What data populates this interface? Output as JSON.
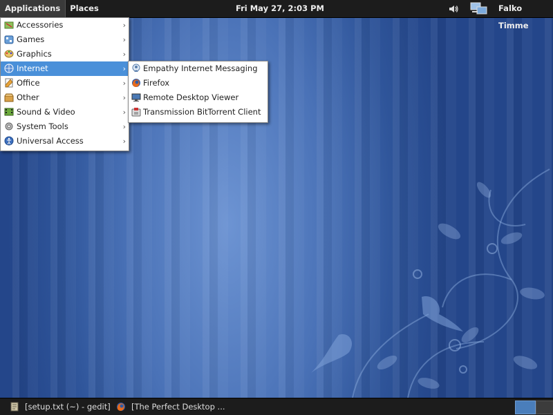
{
  "top_panel": {
    "applications_label": "Applications",
    "places_label": "Places",
    "clock": "Fri May 27,  2:03 PM",
    "user_name": "Falko Timme"
  },
  "apps_menu": {
    "items": [
      {
        "label": "Accessories",
        "icon": "accessories-icon"
      },
      {
        "label": "Games",
        "icon": "games-icon"
      },
      {
        "label": "Graphics",
        "icon": "graphics-icon"
      },
      {
        "label": "Internet",
        "icon": "internet-icon",
        "active": true
      },
      {
        "label": "Office",
        "icon": "office-icon"
      },
      {
        "label": "Other",
        "icon": "other-icon"
      },
      {
        "label": "Sound & Video",
        "icon": "sound-video-icon"
      },
      {
        "label": "System Tools",
        "icon": "system-tools-icon"
      },
      {
        "label": "Universal Access",
        "icon": "universal-access-icon"
      }
    ]
  },
  "internet_submenu": {
    "items": [
      {
        "label": "Empathy Internet Messaging",
        "icon": "empathy-icon"
      },
      {
        "label": "Firefox",
        "icon": "firefox-icon"
      },
      {
        "label": "Remote Desktop Viewer",
        "icon": "remote-desktop-icon"
      },
      {
        "label": "Transmission BitTorrent Client",
        "icon": "transmission-icon"
      }
    ]
  },
  "taskbar": {
    "tasks": [
      {
        "label": "[setup.txt (~) - gedit]",
        "icon": "gedit-icon"
      },
      {
        "label": "[The Perfect Desktop ...",
        "icon": "firefox-icon"
      }
    ]
  },
  "colors": {
    "panel_bg": "#1c1c1c",
    "menu_highlight": "#4a90d9",
    "desktop_blue": "#2c4f8f"
  }
}
